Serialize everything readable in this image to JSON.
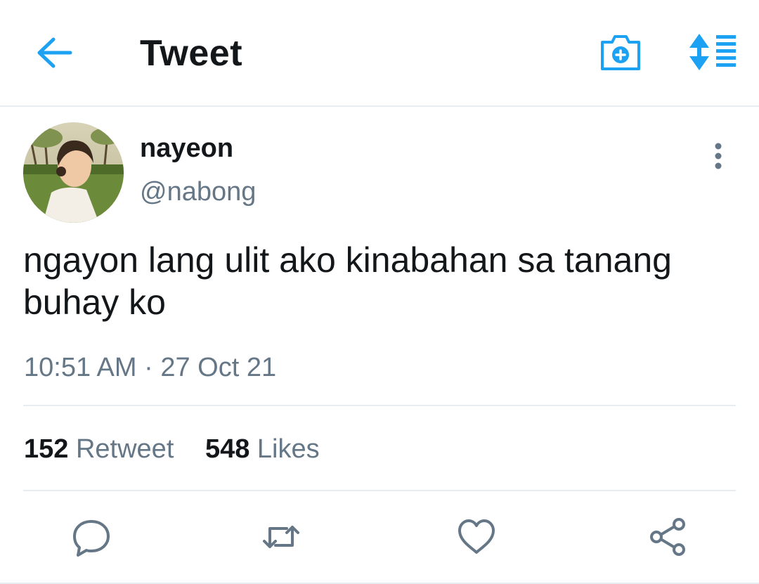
{
  "header": {
    "title": "Tweet",
    "back_icon": "back-arrow-icon",
    "camera_icon": "camera-add-icon",
    "sort_icon": "sort-list-icon",
    "accent_color": "#1da1f2"
  },
  "tweet": {
    "display_name": "nayeon",
    "handle": "@nabong",
    "text_line1": "ngayon lang ulit ako kinabahan sa tanang",
    "text_line2": "buhay ko",
    "timestamp": "10:51 AM · 27 Oct 21",
    "more_icon": "more-vertical-icon"
  },
  "stats": {
    "retweets_count": "152",
    "retweets_label": "Retweet",
    "likes_count": "548",
    "likes_label": "Likes"
  },
  "actions": {
    "reply_icon": "reply-icon",
    "retweet_icon": "retweet-icon",
    "like_icon": "heart-icon",
    "share_icon": "share-icon",
    "icon_color": "#657786"
  },
  "colors": {
    "text_primary": "#14171a",
    "text_secondary": "#657786",
    "divider": "#e6ecf0"
  }
}
